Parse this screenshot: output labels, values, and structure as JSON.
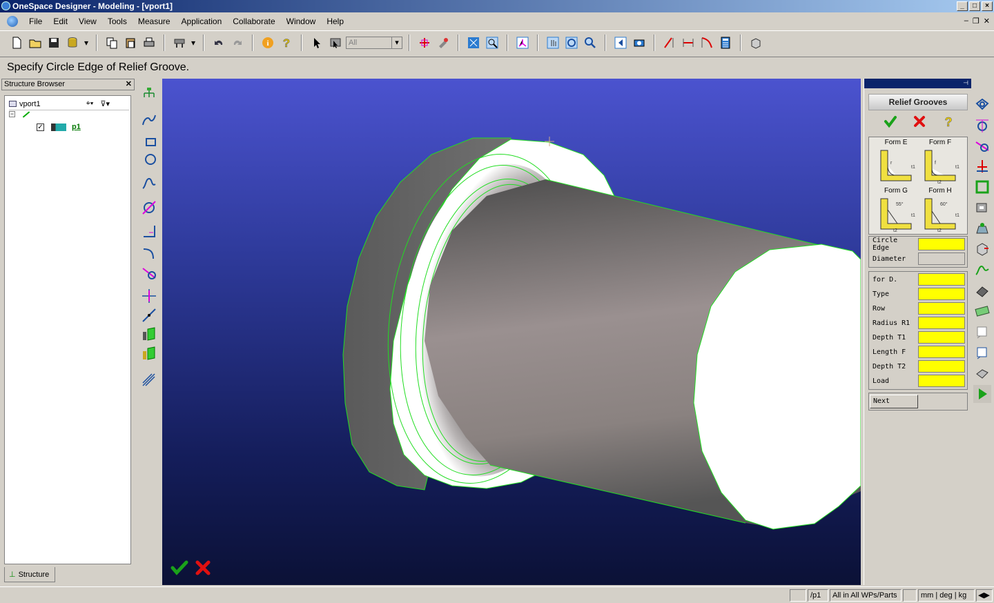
{
  "window": {
    "title": "OneSpace Designer - Modeling - [vport1]",
    "controls": [
      "_",
      "□",
      "×"
    ]
  },
  "menu": [
    "File",
    "Edit",
    "View",
    "Tools",
    "Measure",
    "Application",
    "Collaborate",
    "Window",
    "Help"
  ],
  "toolbar": {
    "selection_filter": "All"
  },
  "prompt": "Specify Circle Edge of Relief Groove.",
  "structure_browser": {
    "title": "Structure Browser",
    "root": "vport1",
    "part": "p1",
    "tab": "Structure"
  },
  "relief_panel": {
    "title": "Relief Grooves",
    "forms": [
      "Form E",
      "Form F",
      "Form G",
      "Form H"
    ],
    "fields_top": [
      {
        "label": "Circle Edge",
        "state": "active"
      },
      {
        "label": "Diameter",
        "state": "disabled"
      }
    ],
    "fields": [
      "for D.",
      "Type",
      "Row",
      "Radius R1",
      "Depth T1",
      "Length F",
      "Depth T2",
      "Load"
    ],
    "next": "Next",
    "form_labels": {
      "t1": "t1",
      "t2": "t2",
      "f": "f",
      "r": "r",
      "a55": "55°",
      "a60": "60°"
    }
  },
  "status": {
    "part": "/p1",
    "scope": "All in All WPs/Parts",
    "units": "mm | deg | kg"
  },
  "colors": {
    "highlight_yellow": "#ffff00",
    "edge_green": "#22dd22",
    "viewport_top": "#4b53cf",
    "viewport_bottom": "#0b1136",
    "title_bar": "#0a246a"
  }
}
